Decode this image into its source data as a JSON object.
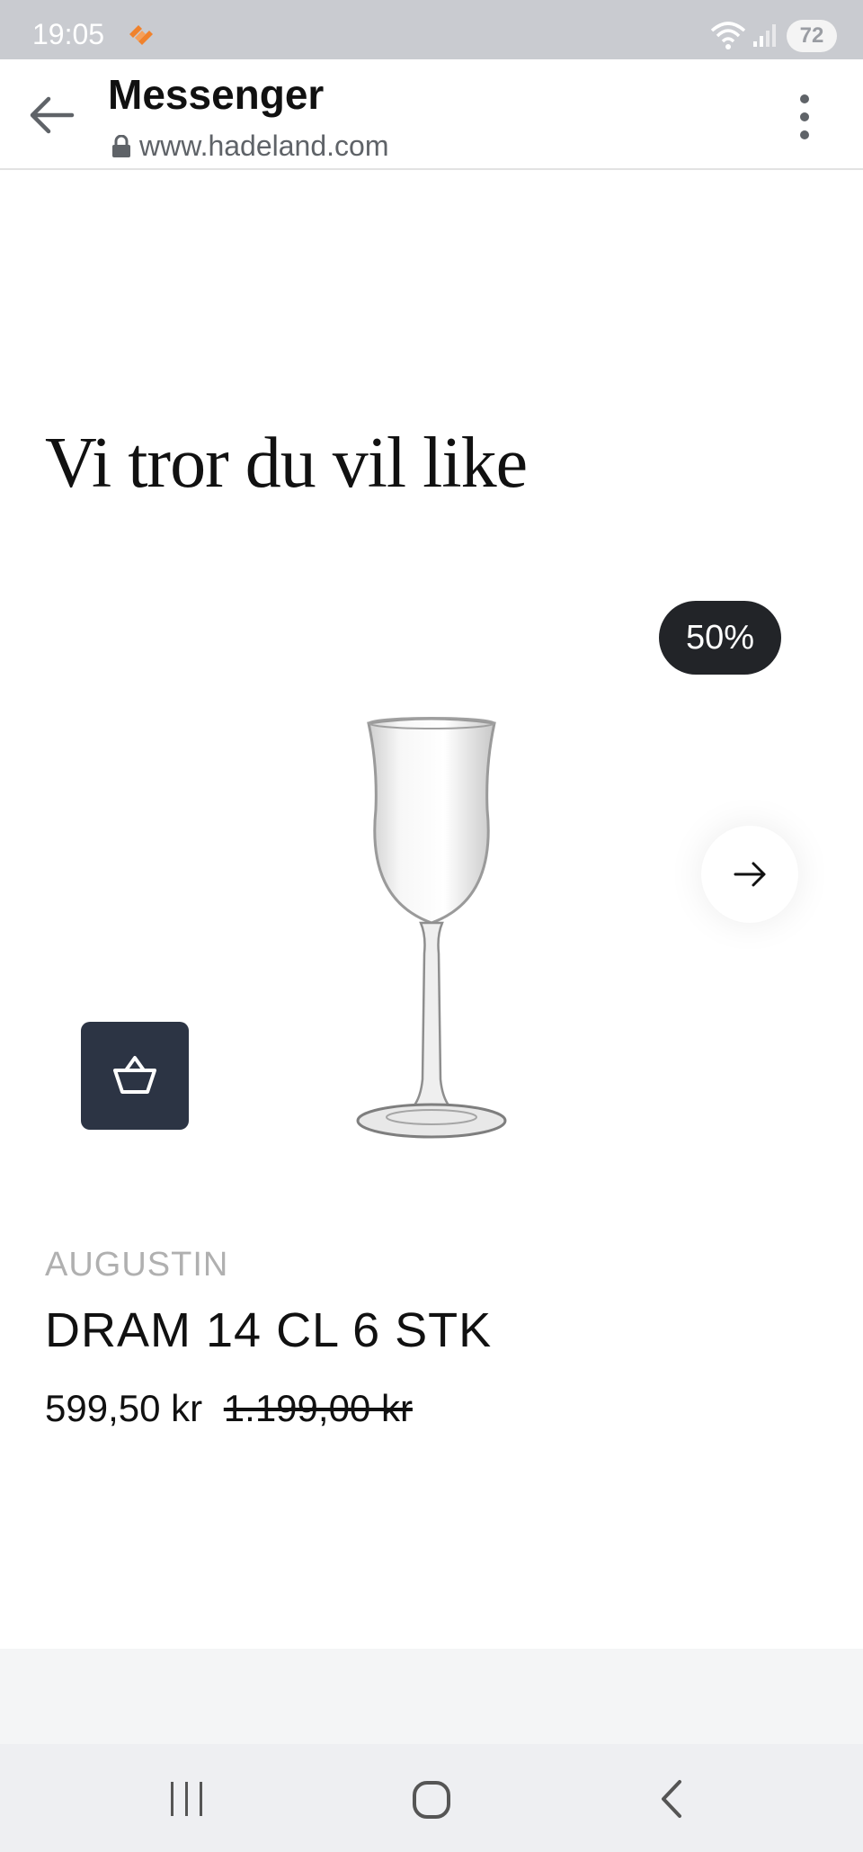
{
  "status_bar": {
    "time": "19:05",
    "battery": "72",
    "icons": [
      "app-notification-icon",
      "wifi-icon",
      "signal-icon",
      "battery-icon"
    ]
  },
  "browser": {
    "title": "Messenger",
    "url": "www.hadeland.com",
    "icons": [
      "back-arrow-icon",
      "lock-icon",
      "more-vertical-icon"
    ]
  },
  "section": {
    "title": "Vi tror du vil like"
  },
  "product": {
    "discount_badge": "50%",
    "brand": "AUGUSTIN",
    "name": "DRAM 14 CL 6 STK",
    "price": "599,50 kr",
    "old_price": "1.199,00 kr",
    "image_icon": "glass-image",
    "basket_icon": "basket-icon"
  },
  "carousel": {
    "next_icon": "arrow-right-icon"
  },
  "nav_bar": {
    "icons": [
      "recent-apps-icon",
      "home-icon",
      "back-icon"
    ]
  },
  "colors": {
    "status_bar_bg": "#c9cbd0",
    "badge_bg": "#222428",
    "basket_bg": "#2c3444",
    "brand_text": "#b0b0b0",
    "nav_bg": "#eeeff2"
  }
}
